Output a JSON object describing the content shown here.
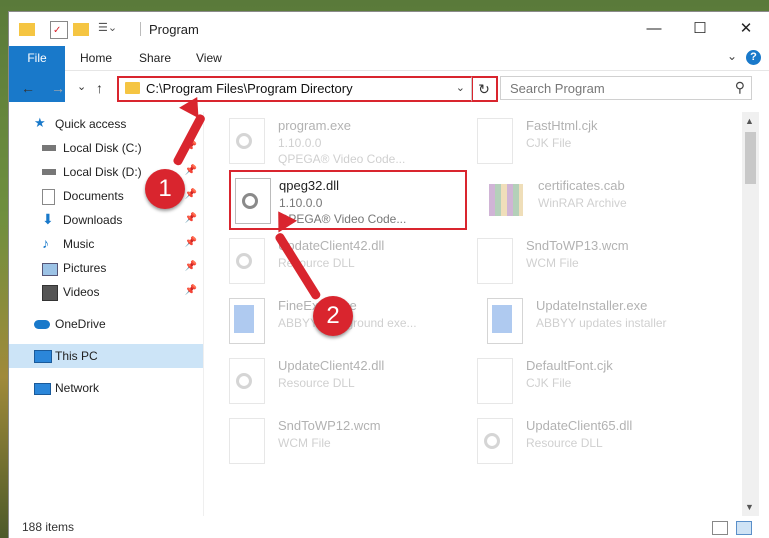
{
  "window": {
    "title": "Program",
    "controls": {
      "minimize": "—",
      "maximize": "☐",
      "close": "✕"
    }
  },
  "ribbon": {
    "tabs": [
      "File",
      "Home",
      "Share",
      "View"
    ],
    "help": "?",
    "chevron": "⌄"
  },
  "nav": {
    "back": "←",
    "forward": "→",
    "recent": "⌄",
    "up": "↑",
    "address_path": "C:\\Program Files\\Program Directory",
    "address_dropdown": "⌄",
    "refresh": "↻",
    "search_placeholder": "Search Program",
    "search_icon": "⚲"
  },
  "sidebar": {
    "items": [
      {
        "label": "Quick access",
        "icon": "star-icon"
      },
      {
        "label": "Local Disk (C:)",
        "icon": "drive-icon",
        "pinned": true
      },
      {
        "label": "Local Disk (D:)",
        "icon": "drive-icon",
        "pinned": true
      },
      {
        "label": "Documents",
        "icon": "documents-icon",
        "pinned": true
      },
      {
        "label": "Downloads",
        "icon": "downloads-icon",
        "pinned": true
      },
      {
        "label": "Music",
        "icon": "music-icon",
        "pinned": true
      },
      {
        "label": "Pictures",
        "icon": "pictures-icon",
        "pinned": true
      },
      {
        "label": "Videos",
        "icon": "videos-icon",
        "pinned": true
      },
      {
        "label": "OneDrive",
        "icon": "cloud-icon"
      },
      {
        "label": "This PC",
        "icon": "computer-icon",
        "selected": true
      },
      {
        "label": "Network",
        "icon": "network-icon"
      }
    ],
    "pin_glyph": "📌"
  },
  "files": [
    {
      "name": "program.exe",
      "line2": "1.10.0.0",
      "line3": "QPEGA® Video Code...",
      "icon": "exe-icon",
      "faded": true
    },
    {
      "name": "FastHtml.cjk",
      "line2": "CJK File",
      "line3": "",
      "icon": "file-icon",
      "faded": true
    },
    {
      "name": "qpeg32.dll",
      "line2": "1.10.0.0",
      "line3": "QPEGA® Video Code...",
      "icon": "dll-gear-icon",
      "faded": false,
      "highlighted": true
    },
    {
      "name": "certificates.cab",
      "line2": "WinRAR Archive",
      "line3": "",
      "icon": "archive-icon",
      "faded": true
    },
    {
      "name": "UpdateClient42.dll",
      "line2": "Resource DLL",
      "line3": "",
      "icon": "dll-gear-icon",
      "faded": true
    },
    {
      "name": "SndToWP13.wcm",
      "line2": "WCM File",
      "line3": "",
      "icon": "file-icon",
      "faded": true
    },
    {
      "name": "FineExec.exe",
      "line2": "ABBYY background exe...",
      "line3": "",
      "icon": "app-window-icon",
      "faded": true
    },
    {
      "name": "UpdateInstaller.exe",
      "line2": "ABBYY updates installer",
      "line3": "",
      "icon": "app-window-icon",
      "faded": true
    },
    {
      "name": "UpdateClient42.dll",
      "line2": "Resource DLL",
      "line3": "",
      "icon": "dll-gear-icon",
      "faded": true
    },
    {
      "name": "DefaultFont.cjk",
      "line2": "CJK File",
      "line3": "",
      "icon": "file-icon",
      "faded": true
    },
    {
      "name": "SndToWP12.wcm",
      "line2": "WCM File",
      "line3": "",
      "icon": "file-icon",
      "faded": true
    },
    {
      "name": "UpdateClient65.dll",
      "line2": "Resource DLL",
      "line3": "",
      "icon": "dll-gear-icon",
      "faded": true
    }
  ],
  "callouts": [
    "1",
    "2"
  ],
  "status": {
    "count": "188 items"
  },
  "colors": {
    "accent": "#1979ca",
    "highlight": "#d9252e",
    "selected": "#cce4f7"
  }
}
